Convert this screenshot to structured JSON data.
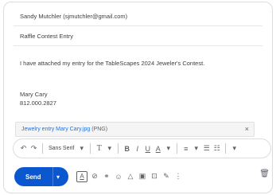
{
  "compose": {
    "to": "Sandy Mutchler (sjmutchler@gmail.com)",
    "subject": "Raffle Contest Entry",
    "body": "I have attached my entry for the TableScapes 2024 Jeweler's Contest.",
    "signature_name": "Mary Cary",
    "signature_phone": "812.000.2827"
  },
  "attachment": {
    "filename": "Jewelry entry Mary Cary.jpg",
    "type": "(PNG)",
    "close_glyph": "×"
  },
  "format_toolbar": {
    "undo": "↶",
    "redo": "↷",
    "font": "Sans Serif",
    "font_caret": "▾",
    "size": "T",
    "size_caret": "▾",
    "bold": "B",
    "italic": "I",
    "underline": "U",
    "text_color": "A",
    "text_color_caret": "▾",
    "align": "≡",
    "align_caret": "▾",
    "numbered_list": "☰",
    "bulleted_list": "☷",
    "more": "▾"
  },
  "send_bar": {
    "send_label": "Send",
    "schedule_caret": "▾",
    "formatting": "A",
    "attach": "⊘",
    "link": "⚭",
    "emoji": "☺",
    "drive": "△",
    "photo": "▣",
    "lock": "⊡",
    "signature": "✎",
    "more": "⋮",
    "trash": "🗑"
  }
}
